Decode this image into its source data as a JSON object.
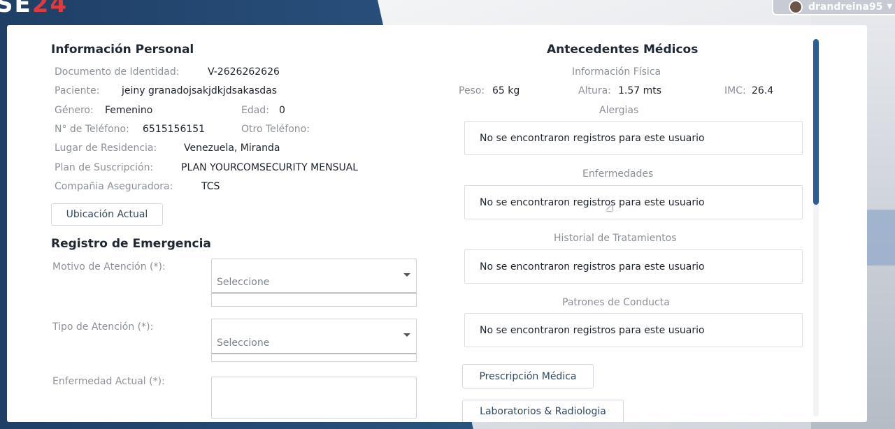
{
  "app": {
    "logo_text": "SE",
    "logo_number": "24"
  },
  "user": {
    "name": "drandreina95"
  },
  "personal": {
    "title": "Información Personal",
    "doc_label": "Documento de Identidad:",
    "doc_value": "V-2626262626",
    "patient_label": "Paciente:",
    "patient_value": "jeiny granadojsakjdkjdsakasdas",
    "gender_label": "Género:",
    "gender_value": "Femenino",
    "age_label": "Edad:",
    "age_value": "0",
    "phone_label": "N° de Teléfono:",
    "phone_value": "6515156151",
    "other_phone_label": "Otro Teléfono:",
    "residence_label": "Lugar de Residencia:",
    "residence_value": "Venezuela, Miranda",
    "plan_label": "Plan de Suscripción:",
    "plan_value": "PLAN YOURCOMSECURITY MENSUAL",
    "insurer_label": "Compañia Aseguradora:",
    "insurer_value": "TCS",
    "location_button": "Ubicación Actual"
  },
  "emergency": {
    "title": "Registro de Emergencia",
    "reason_label": "Motivo de Atención (*):",
    "reason_placeholder": "Seleccione",
    "type_label": "Tipo de Atención (*):",
    "type_placeholder": "Seleccione",
    "illness_label": "Enfermedad Actual (*):"
  },
  "medical": {
    "title": "Antecedentes Médicos",
    "physical_head": "Información Física",
    "weight_label": "Peso:",
    "weight_value": "65 kg",
    "height_label": "Altura:",
    "height_value": "1.57 mts",
    "bmi_label": "IMC:",
    "bmi_value": "26.4",
    "allergies_head": "Alergias",
    "allergies_text": "No se encontraron registros para este usuario",
    "diseases_head": "Enfermedades",
    "diseases_text": "No se encontraron registros para este usuario",
    "treatments_head": "Historial de Tratamientos",
    "treatments_text": "No se encontraron registros para este usuario",
    "behavior_head": "Patrones de Conducta",
    "behavior_text": "No se encontraron registros para este usuario",
    "prescription_button": "Prescripción Médica",
    "labs_button": "Laboratorios & Radiologia"
  },
  "colors": {
    "header_blue": "#2b5582",
    "accent_red": "#e23a3a",
    "scroll_blue": "#2c5d9a"
  }
}
